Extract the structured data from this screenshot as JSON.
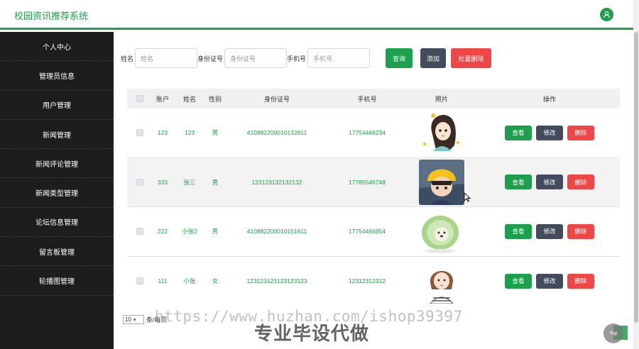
{
  "header": {
    "title": "校园资讯推荐系统",
    "user_icon": "user-icon"
  },
  "colors": {
    "accent": "#1ca04d",
    "sidebar_bg": "#1d1d1d",
    "dark_button": "#434b5c",
    "danger": "#f04646"
  },
  "sidebar": {
    "items": [
      {
        "label": "个人中心"
      },
      {
        "label": "管理员信息"
      },
      {
        "label": "用户管理"
      },
      {
        "label": "新闻管理"
      },
      {
        "label": "新闻评论管理"
      },
      {
        "label": "新闻类型管理"
      },
      {
        "label": "论坛信息管理"
      },
      {
        "label": "留言板管理"
      },
      {
        "label": "轮播图管理"
      }
    ]
  },
  "search": {
    "name_label": "姓名",
    "name_placeholder": "姓名",
    "id_label": "身份证号",
    "id_placeholder": "身份证号",
    "phone_label": "手机号",
    "phone_placeholder": "手机号",
    "query_button": "查询",
    "add_button": "添加",
    "batch_delete_button": "批量删除"
  },
  "table": {
    "headers": {
      "account": "账户",
      "name": "姓名",
      "gender": "性别",
      "id_number": "身份证号",
      "phone": "手机号",
      "photo": "照片",
      "ops": "操作"
    },
    "rows": [
      {
        "account": "123",
        "name": "123",
        "gender": "男",
        "id_number": "410882200010132611",
        "phone": "17754466234",
        "photo": "cartoon-girl-avatar"
      },
      {
        "account": "333",
        "name": "张三",
        "gender": "男",
        "id_number": "123123132132132",
        "phone": "17785546748",
        "photo": "anime-boy-yellow-hat"
      },
      {
        "account": "222",
        "name": "小张2",
        "gender": "男",
        "id_number": "410882200010151611",
        "phone": "17754466854",
        "photo": "cabbage-dog"
      },
      {
        "account": "111",
        "name": "小张",
        "gender": "女",
        "id_number": "123123123123123123",
        "phone": "12312312312",
        "photo": "cartoon-girl-striped"
      }
    ],
    "view_label": "查看",
    "edit_label": "修改",
    "delete_label": "删除"
  },
  "pagination": {
    "page_size": "10",
    "per_page_label": "条/每页"
  },
  "watermark": {
    "url": "https://www.huzhan.com/ishop39397",
    "text": "专业毕设代做"
  },
  "back_to_top": "Top"
}
